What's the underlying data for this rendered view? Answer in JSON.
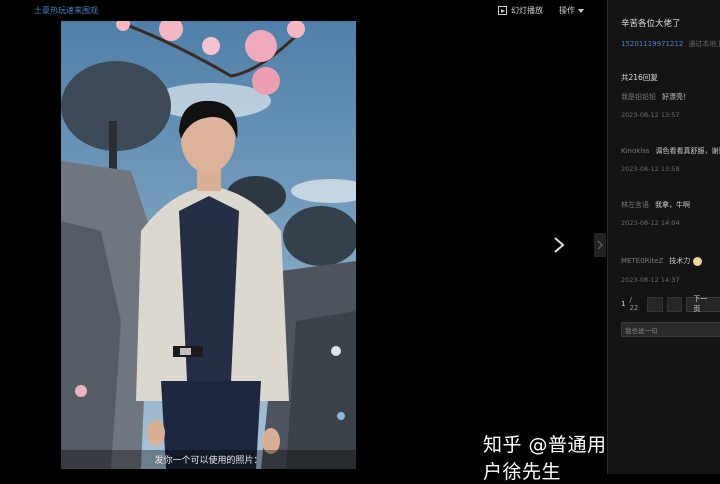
{
  "topbar": {
    "back_link": "土豪热玩速来围观",
    "slideshow_label": "幻灯播放",
    "operations_label": "操作"
  },
  "photo": {
    "caption": "发你一个可以使用的照片："
  },
  "sidebar": {
    "title": "辛苦各位大佬了",
    "author": "15201119971212",
    "via": "通过本地上传",
    "reply_count": "共216回复",
    "comments": [
      {
        "user": "我是铅铅铅",
        "text": "好漂亮！",
        "time": "2023-08-12 13:57"
      },
      {
        "user": "Kinokiss",
        "text": "调色看看真舒服，谢谢",
        "time": "2023-08-12 13:58"
      },
      {
        "user": "林左言语",
        "text": "我拿，牛啊",
        "time": "2023-08-12 14:04"
      },
      {
        "user": "METE0RiteZ",
        "text": "技术力",
        "time": "2023-08-12 14:37"
      }
    ],
    "pager": {
      "current": "1",
      "total": "/ 22",
      "next_label": "下一页"
    },
    "reply_placeholder": "我也说一句"
  },
  "watermark": "知乎 @普通用户徐先生",
  "colors": {
    "background": "#000000",
    "sidebar": "#141414",
    "link": "#4a83c4"
  }
}
